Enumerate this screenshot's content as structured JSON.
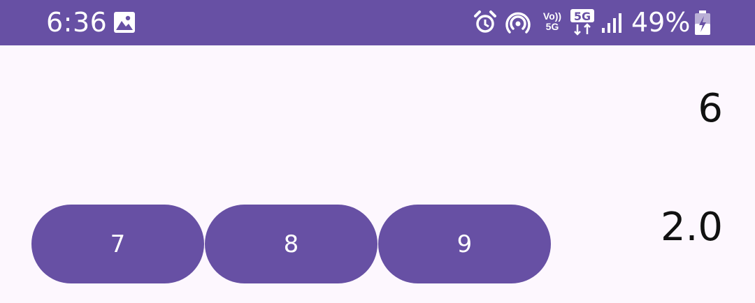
{
  "status_bar": {
    "time": "6:36",
    "battery_percent": "49%",
    "volte_label_top": "Vo))",
    "volte_label_bottom": "5G",
    "network_label": "5G",
    "icons": [
      "gallery-icon",
      "alarm-icon",
      "hotspot-icon",
      "volte-icon",
      "5g-data-icon",
      "signal-icon",
      "battery-charging-icon"
    ],
    "background_color": "#6750a4"
  },
  "display": {
    "result": "6",
    "memory": "2.0"
  },
  "keypad": {
    "keys": [
      {
        "label": "7"
      },
      {
        "label": "8"
      },
      {
        "label": "9"
      }
    ],
    "key_color": "#6750a4"
  },
  "colors": {
    "background": "#fdf7fe",
    "accent": "#6750a4"
  }
}
